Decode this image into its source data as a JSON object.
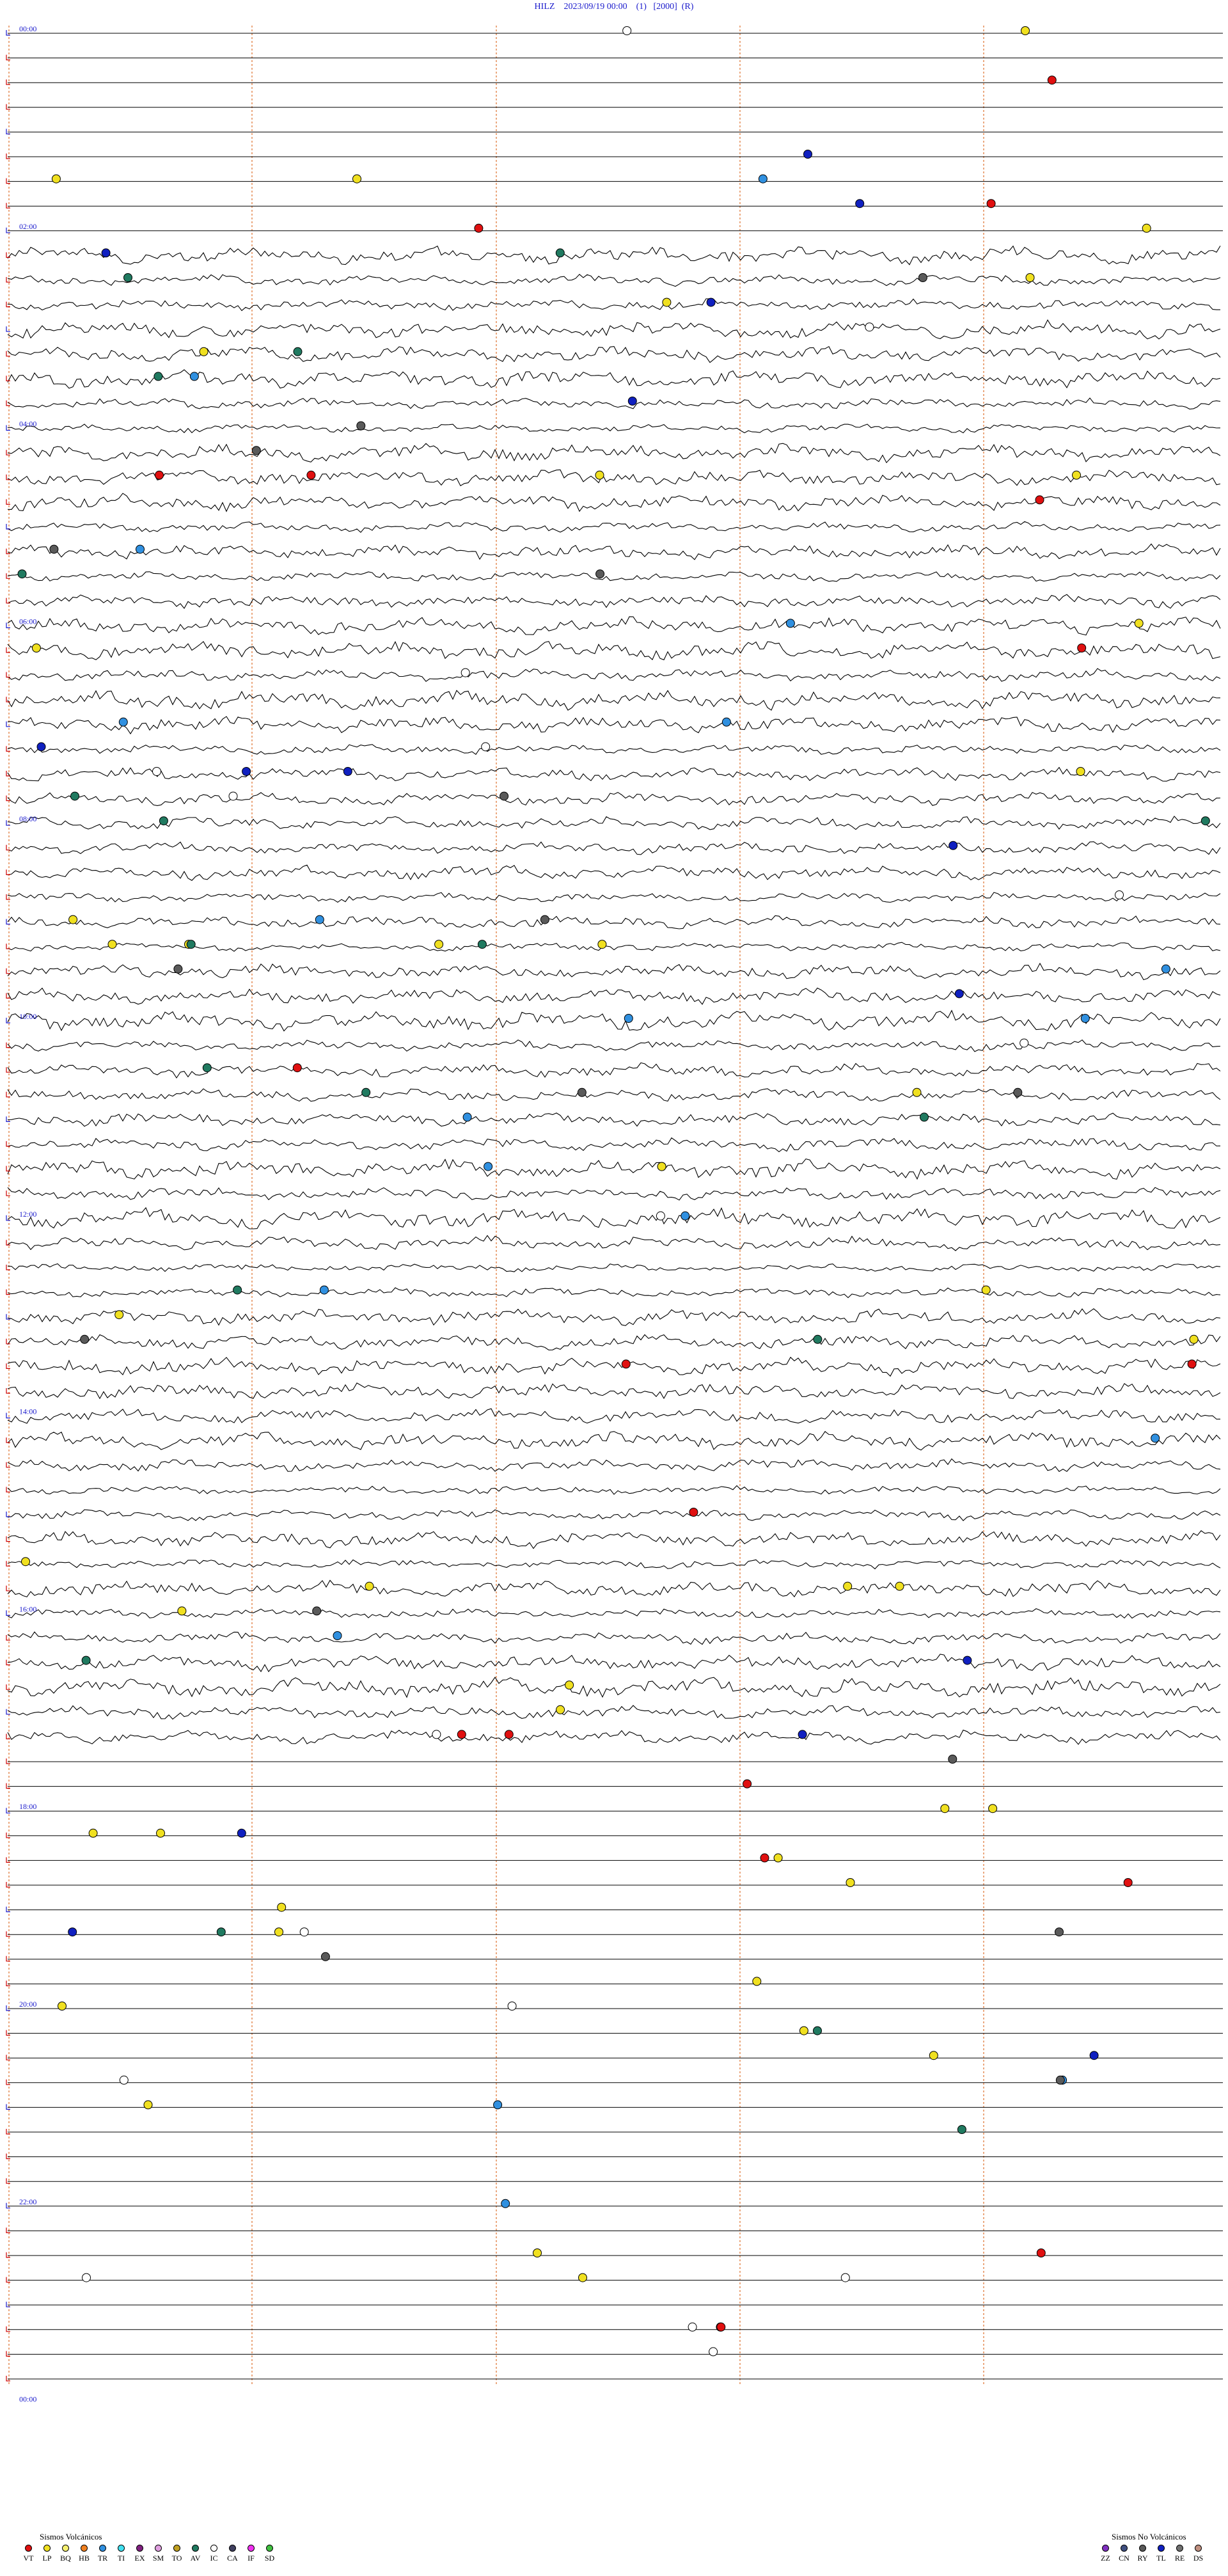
{
  "header": {
    "station": "HILZ",
    "datetime": "2023/09/19 00:00",
    "channel": "(1)",
    "scale": "[2000]",
    "flag": "(R)"
  },
  "chart_data": {
    "type": "helicorder",
    "row_minutes": 15,
    "rows": 96,
    "hour_labels": [
      "00:00",
      "02:00",
      "04:00",
      "06:00",
      "08:00",
      "10:00",
      "12:00",
      "14:00",
      "16:00",
      "18:00",
      "20:00",
      "22:00",
      "00:00"
    ],
    "active_rows_range": [
      9,
      69
    ],
    "colors": {
      "trace": "#000000",
      "gridline": "#e07a3a",
      "label": "#1a1acc",
      "marker_start": "#cc0000"
    }
  },
  "legend_volcanic": {
    "title": "Sismos Volcánicos",
    "items": [
      {
        "code": "VT",
        "color": "#e01010"
      },
      {
        "code": "LP",
        "color": "#f0e020"
      },
      {
        "code": "BQ",
        "color": "#f5f070"
      },
      {
        "code": "HB",
        "color": "#f08020"
      },
      {
        "code": "TR",
        "color": "#3090e0"
      },
      {
        "code": "TI",
        "color": "#40e0f0"
      },
      {
        "code": "EX",
        "color": "#802080"
      },
      {
        "code": "SM",
        "color": "#e0a0e0"
      },
      {
        "code": "TO",
        "color": "#c0a020"
      },
      {
        "code": "AV",
        "color": "#207a60"
      },
      {
        "code": "IC",
        "color": "#ffffff"
      },
      {
        "code": "CA",
        "color": "#404060"
      },
      {
        "code": "IF",
        "color": "#f030f0"
      },
      {
        "code": "SD",
        "color": "#40c040"
      }
    ]
  },
  "legend_nonvolcanic": {
    "title": "Sismos No Volcánicos",
    "items": [
      {
        "code": "ZZ",
        "color": "#8030c0"
      },
      {
        "code": "CN",
        "color": "#405080"
      },
      {
        "code": "RY",
        "color": "#5a5a5a"
      },
      {
        "code": "TL",
        "color": "#1020c0"
      },
      {
        "code": "RE",
        "color": "#707070"
      },
      {
        "code": "DS",
        "color": "#c09080"
      }
    ]
  }
}
